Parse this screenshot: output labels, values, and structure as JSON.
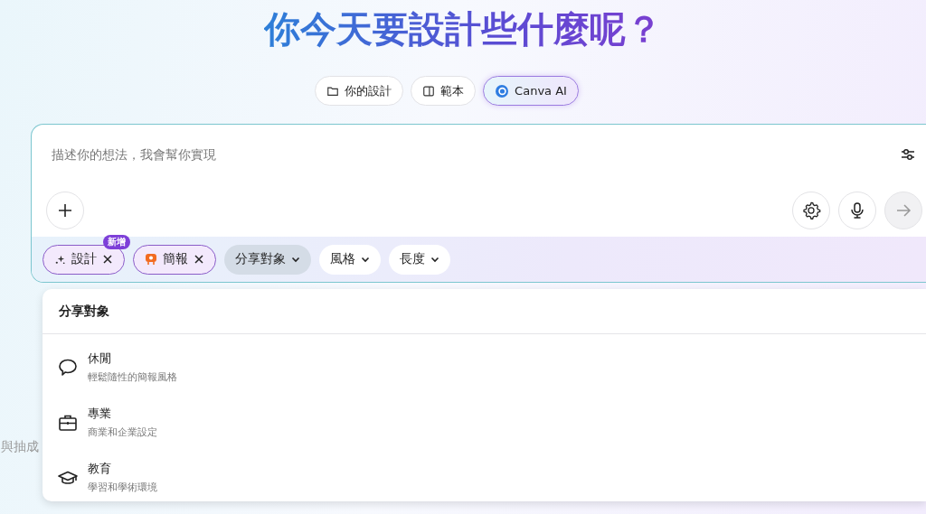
{
  "heading": "你今天要設計些什麼呢？",
  "tabs": [
    {
      "label": "你的設計",
      "selected": false
    },
    {
      "label": "範本",
      "selected": false
    },
    {
      "label": "Canva AI",
      "selected": true
    }
  ],
  "prompt": {
    "placeholder": "描述你的想法，我會幫你實現"
  },
  "chips": [
    {
      "kind": "tag",
      "label": "設計",
      "badge": "新增",
      "selected": false
    },
    {
      "kind": "tag",
      "label": "簡報",
      "selected": false
    },
    {
      "kind": "dropdown",
      "label": "分享對象",
      "selected": true
    },
    {
      "kind": "dropdown",
      "label": "風格",
      "selected": false
    },
    {
      "kind": "dropdown",
      "label": "長度",
      "selected": false
    }
  ],
  "menu": {
    "title": "分享對象",
    "items": [
      {
        "label": "休閒",
        "description": "輕鬆隨性的簡報風格"
      },
      {
        "label": "專業",
        "description": "商業和企業設定"
      },
      {
        "label": "教育",
        "description": "學習和學術環境"
      }
    ]
  },
  "background_text": "與抽成"
}
